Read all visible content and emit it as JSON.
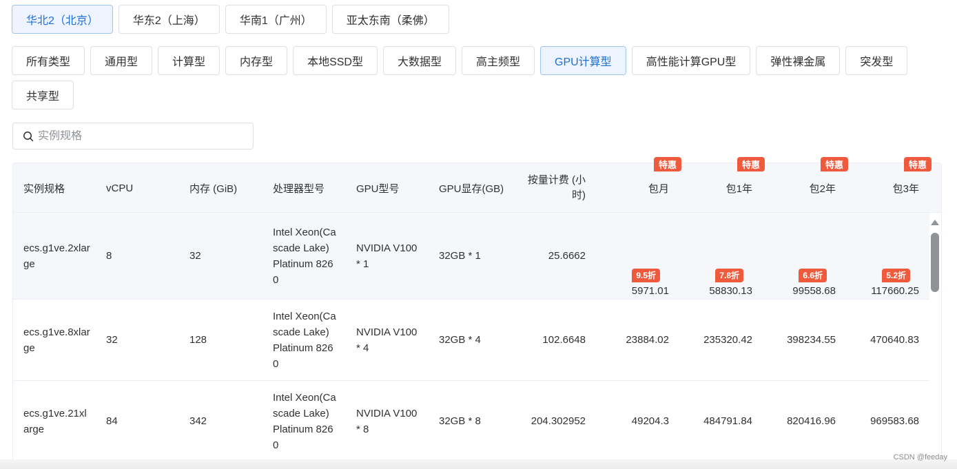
{
  "regions": [
    {
      "label": "华北2（北京）",
      "active": true
    },
    {
      "label": "华东2（上海）",
      "active": false
    },
    {
      "label": "华南1（广州）",
      "active": false
    },
    {
      "label": "亚太东南（柔佛）",
      "active": false
    }
  ],
  "types": [
    {
      "label": "所有类型",
      "active": false
    },
    {
      "label": "通用型",
      "active": false
    },
    {
      "label": "计算型",
      "active": false
    },
    {
      "label": "内存型",
      "active": false
    },
    {
      "label": "本地SSD型",
      "active": false
    },
    {
      "label": "大数据型",
      "active": false
    },
    {
      "label": "高主频型",
      "active": false
    },
    {
      "label": "GPU计算型",
      "active": true
    },
    {
      "label": "高性能计算GPU型",
      "active": false
    },
    {
      "label": "弹性裸金属",
      "active": false
    },
    {
      "label": "突发型",
      "active": false
    },
    {
      "label": "共享型",
      "active": false
    }
  ],
  "search": {
    "placeholder": "实例规格",
    "value": ""
  },
  "table": {
    "headers": {
      "spec": "实例规格",
      "vcpu": "vCPU",
      "memory": "内存 (GiB)",
      "cpu": "处理器型号",
      "gpu": "GPU型号",
      "gpu_mem": "GPU显存(GB)",
      "hourly_line1": "按量计费 (小",
      "hourly_line2": "时)",
      "monthly": "包月",
      "year1": "包1年",
      "year2": "包2年",
      "year3": "包3年"
    },
    "promo_badge": "特惠",
    "rows": [
      {
        "spec": "ecs.g1ve.2xlarge",
        "vcpu": "8",
        "memory": "32",
        "cpu": "Intel Xeon(Cascade Lake) Platinum 8260",
        "gpu": "NVIDIA V100 * 1",
        "gpu_mem": "32GB * 1",
        "hourly": "25.6662",
        "monthly": "5971.01",
        "year1": "58830.13",
        "year2": "99558.68",
        "year3": "117660.25",
        "discounts": {
          "monthly": "9.5折",
          "year1": "7.8折",
          "year2": "6.6折",
          "year3": "5.2折"
        }
      },
      {
        "spec": "ecs.g1ve.8xlarge",
        "vcpu": "32",
        "memory": "128",
        "cpu": "Intel Xeon(Cascade Lake) Platinum 8260",
        "gpu": "NVIDIA V100 * 4",
        "gpu_mem": "32GB * 4",
        "hourly": "102.6648",
        "monthly": "23884.02",
        "year1": "235320.42",
        "year2": "398234.55",
        "year3": "470640.83"
      },
      {
        "spec": "ecs.g1ve.21xlarge",
        "vcpu": "84",
        "memory": "342",
        "cpu": "Intel Xeon(Cascade Lake) Platinum 8260",
        "gpu": "NVIDIA V100 * 8",
        "gpu_mem": "32GB * 8",
        "hourly": "204.302952",
        "monthly": "49204.3",
        "year1": "484791.84",
        "year2": "820416.96",
        "year3": "969583.68"
      }
    ]
  },
  "watermark": "CSDN @feeday",
  "colors": {
    "accent": "#1f6fd6",
    "promo": "#f05a3c",
    "header_bg": "#f5f7fa"
  }
}
